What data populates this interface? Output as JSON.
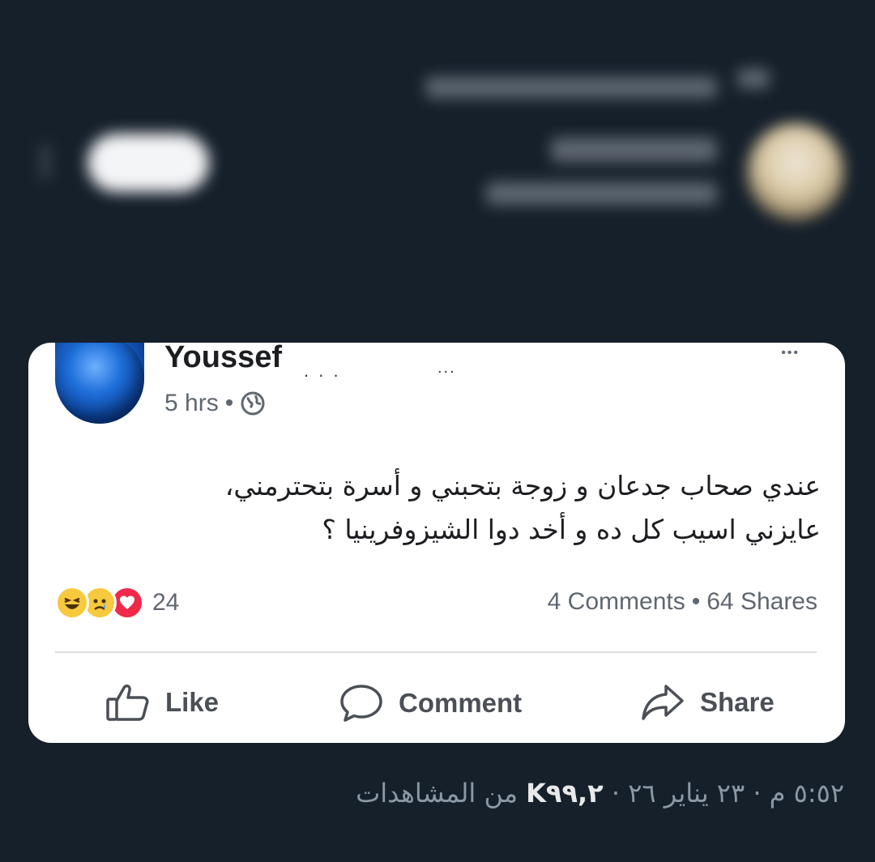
{
  "post": {
    "author_name": "Youssef",
    "time": "5 hrs",
    "separator": "•",
    "more_glyph": "•••",
    "text_line1": "عندي صحاب جدعان  و زوجة بتحبني و أسرة بتحترمني،",
    "text_line2": "عايزني اسيب كل ده و أخد دوا الشيزوفرينيا ؟",
    "reaction_count": "24",
    "comments": "4 Comments",
    "shares": "64 Shares",
    "reactions": [
      "haha-icon",
      "sad-icon",
      "love-icon"
    ]
  },
  "actions": {
    "like": "Like",
    "comment": "Comment",
    "share": "Share"
  },
  "tweet": {
    "time": "٥:٥٢ م",
    "dot": "·",
    "date": "٢٣ يناير ٢٦",
    "views_count": "K٩٩,٢",
    "views_label": "من المشاهدات"
  },
  "colors": {
    "background": "#16202b",
    "card": "#ffffff",
    "text_primary": "#1c1e21",
    "text_secondary": "#606770",
    "love": "#f02849",
    "reaction_yellow": "#f7c93e"
  }
}
